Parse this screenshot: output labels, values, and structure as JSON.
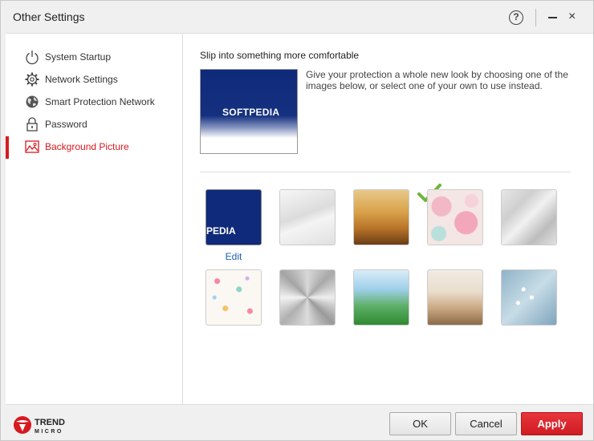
{
  "window": {
    "title": "Other Settings",
    "help": "?",
    "minimize": "–",
    "close": "×"
  },
  "sidebar": {
    "items": [
      {
        "label": "System Startup",
        "icon": "power-icon"
      },
      {
        "label": "Network Settings",
        "icon": "gear-icon"
      },
      {
        "label": "Smart Protection Network",
        "icon": "globe-icon"
      },
      {
        "label": "Password",
        "icon": "lock-icon"
      },
      {
        "label": "Background Picture",
        "icon": "picture-icon",
        "active": true
      }
    ]
  },
  "main": {
    "heading": "Slip into something more comfortable",
    "description": "Give your protection a whole new look by choosing one of the images below, or select one of your own to use instead.",
    "preview_logo": "SOFTPEDIA",
    "selected_thumb_text": "PEDIA",
    "edit_label": "Edit",
    "thumbnails": [
      "custom-softpedia",
      "white-waves",
      "wheat-field",
      "pink-bokeh",
      "grey-polygons",
      "confetti-dots",
      "brushed-metal",
      "green-grass",
      "sandy-beach",
      "blue-blossom"
    ]
  },
  "footer": {
    "brand_line1": "TREND",
    "brand_line2": "MICRO",
    "ok": "OK",
    "cancel": "Cancel",
    "apply": "Apply"
  },
  "colors": {
    "accent": "#d71920",
    "link": "#1a5fb4"
  }
}
